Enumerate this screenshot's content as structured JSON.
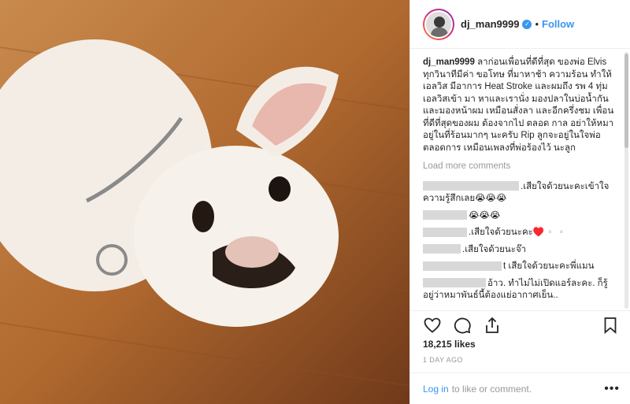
{
  "post": {
    "username": "dj_man9999",
    "follow_label": "Follow",
    "separator": "•",
    "verified_mark": "✓"
  },
  "caption": {
    "username": "dj_man9999",
    "text": "ลาก่อนเพื่อนที่ดีที่สุด ของพ่อ Elvis ทุกวินาทีมีค่า ขอโทษ ที่มาหาช้า ความร้อน ทำให้เอลวิส มีอาการ Heat Stroke และผมถึง รพ 4 ทุ่ม เอลวิสเข้า มา หาและเรานั่ง มองปลาในบ่อน้ำกัน และมองหน้าผม เหมือนสั่งลา และอีกครึ่งชม เพื่อนที่ดีที่สุดของผม ต้องจากไป ตลอด กาล อย่าให้หมาอยู่ในที่ร้อนมากๆ นะครับ Rip ลูกจะอยู่ในใจพ่อตลอดการ เหมือนเพลงที่พ่อร้องไว้ นะลูก"
  },
  "load_more_label": "Load more comments",
  "comments": [
    {
      "text": ".เสียใจด้วยนะคะเข้าใจความรู้สึกเลย😭😭😭"
    },
    {
      "text": "😭😭😭"
    },
    {
      "text": ".เสียใจด้วยนะคะ♥️▫️▫️"
    },
    {
      "text": ".เสียใจด้วยนะจ๊า"
    },
    {
      "text": "t เสียใจด้วยนะคะพี่แมน"
    },
    {
      "text": "อ้าว. ทำไม่ไม่เปิดแอร์ละคะ. ก็รู้อยู่ว่าหมาพันธ์นี้ต้องแย่อากาศเย็น.."
    }
  ],
  "likes": "18,215 likes",
  "timestamp": "1 DAY AGO",
  "login": {
    "link": "Log in",
    "rest": "to like or comment."
  },
  "more_label": "•••",
  "icons": {
    "like": "heart-icon",
    "comment": "comment-icon",
    "share": "share-icon",
    "save": "bookmark-icon"
  },
  "colors": {
    "accent": "#3897f0",
    "muted": "#999999",
    "text": "#262626"
  }
}
